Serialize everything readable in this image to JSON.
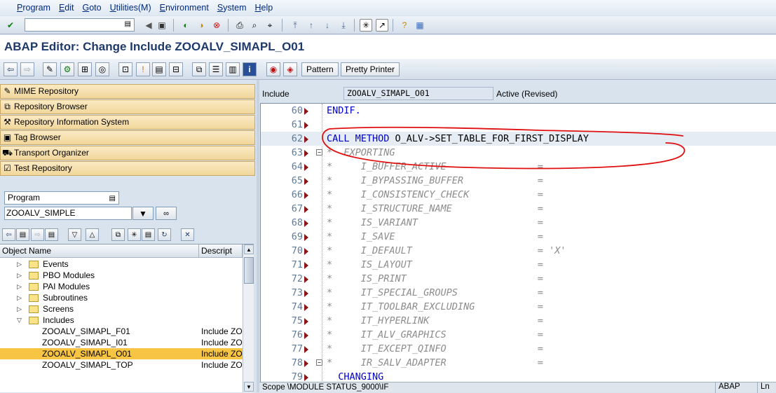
{
  "menu": [
    "Program",
    "Edit",
    "Goto",
    "Utilities(M)",
    "Environment",
    "System",
    "Help"
  ],
  "title": "ABAP Editor: Change Include ZOOALV_SIMAPL_O01",
  "app_toolbar": {
    "pattern_label": "Pattern",
    "pretty_printer_label": "Pretty Printer"
  },
  "nav": [
    {
      "label": "MIME Repository",
      "icon": "mime-icon"
    },
    {
      "label": "Repository Browser",
      "icon": "repository-icon"
    },
    {
      "label": "Repository Information System",
      "icon": "info-system-icon"
    },
    {
      "label": "Tag Browser",
      "icon": "tag-icon"
    },
    {
      "label": "Transport Organizer",
      "icon": "truck-icon"
    },
    {
      "label": "Test Repository",
      "icon": "test-icon"
    }
  ],
  "object_type": "Program",
  "object_name_value": "ZOOALV_SIMPLE",
  "tree": {
    "columns": [
      "Object Name",
      "Descript"
    ],
    "rows": [
      {
        "label": "Events",
        "desc": "",
        "level": 1,
        "folder": true,
        "expanded": false
      },
      {
        "label": "PBO Modules",
        "desc": "",
        "level": 1,
        "folder": true,
        "expanded": false
      },
      {
        "label": "PAI Modules",
        "desc": "",
        "level": 1,
        "folder": true,
        "expanded": false
      },
      {
        "label": "Subroutines",
        "desc": "",
        "level": 1,
        "folder": true,
        "expanded": false
      },
      {
        "label": "Screens",
        "desc": "",
        "level": 1,
        "folder": true,
        "expanded": false
      },
      {
        "label": "Includes",
        "desc": "",
        "level": 1,
        "folder": true,
        "expanded": true
      },
      {
        "label": "ZOOALV_SIMAPL_F01",
        "desc": "Include ZO",
        "level": 2,
        "folder": false
      },
      {
        "label": "ZOOALV_SIMAPL_I01",
        "desc": "Include ZO",
        "level": 2,
        "folder": false
      },
      {
        "label": "ZOOALV_SIMAPL_O01",
        "desc": "Include ZO",
        "level": 2,
        "folder": false,
        "selected": true
      },
      {
        "label": "ZOOALV_SIMAPL_TOP",
        "desc": "Include ZO",
        "level": 2,
        "folder": false
      }
    ]
  },
  "include": {
    "label": "Include",
    "name": "ZOOALV_SIMAPL_O01",
    "status": "Active (Revised)"
  },
  "code_lines": [
    {
      "n": "60",
      "t": "ENDIF.",
      "kind": "kw"
    },
    {
      "n": "61",
      "t": "",
      "kind": "plain"
    },
    {
      "n": "62",
      "t": "CALL METHOD O_ALV->SET_TABLE_FOR_FIRST_DISPLAY",
      "kind": "call",
      "current": true
    },
    {
      "n": "63",
      "t": "*  EXPORTING",
      "kind": "cm",
      "fold": true
    },
    {
      "n": "64",
      "t": "*     I_BUFFER_ACTIVE                =",
      "kind": "cm"
    },
    {
      "n": "65",
      "t": "*     I_BYPASSING_BUFFER             =",
      "kind": "cm"
    },
    {
      "n": "66",
      "t": "*     I_CONSISTENCY_CHECK            =",
      "kind": "cm"
    },
    {
      "n": "67",
      "t": "*     I_STRUCTURE_NAME               =",
      "kind": "cm"
    },
    {
      "n": "68",
      "t": "*     IS_VARIANT                     =",
      "kind": "cm"
    },
    {
      "n": "69",
      "t": "*     I_SAVE                         =",
      "kind": "cm"
    },
    {
      "n": "70",
      "t": "*     I_DEFAULT                      = 'X'",
      "kind": "cm"
    },
    {
      "n": "71",
      "t": "*     IS_LAYOUT                      =",
      "kind": "cm"
    },
    {
      "n": "72",
      "t": "*     IS_PRINT                       =",
      "kind": "cm"
    },
    {
      "n": "73",
      "t": "*     IT_SPECIAL_GROUPS              =",
      "kind": "cm"
    },
    {
      "n": "74",
      "t": "*     IT_TOOLBAR_EXCLUDING           =",
      "kind": "cm"
    },
    {
      "n": "75",
      "t": "*     IT_HYPERLINK                   =",
      "kind": "cm"
    },
    {
      "n": "76",
      "t": "*     IT_ALV_GRAPHICS                =",
      "kind": "cm"
    },
    {
      "n": "77",
      "t": "*     IT_EXCEPT_QINFO                =",
      "kind": "cm"
    },
    {
      "n": "78",
      "t": "*     IR_SALV_ADAPTER                =",
      "kind": "cm",
      "fold": true
    },
    {
      "n": "79",
      "t": "  CHANGING",
      "kind": "kw"
    }
  ],
  "status": {
    "scope": "Scope \\MODULE STATUS_9000\\IF",
    "lang": "ABAP",
    "ln": "Ln"
  },
  "colors": {
    "accent": "#1d3a6b",
    "nav_bg": "#f1d79b",
    "selected_row": "#f8c443",
    "annotation": "#e01010"
  }
}
